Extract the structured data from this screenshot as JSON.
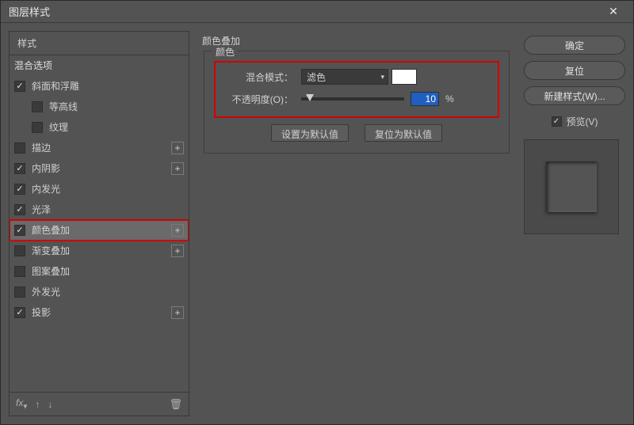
{
  "dialog": {
    "title": "图层样式"
  },
  "left": {
    "styles_header": "样式",
    "blend_options": "混合选项",
    "items": [
      {
        "label": "斜面和浮雕",
        "checked": true,
        "add": false
      },
      {
        "label": "等高线",
        "checked": false,
        "add": false,
        "sub": true
      },
      {
        "label": "纹理",
        "checked": false,
        "add": false,
        "sub": true
      },
      {
        "label": "描边",
        "checked": false,
        "add": true
      },
      {
        "label": "内阴影",
        "checked": true,
        "add": true
      },
      {
        "label": "内发光",
        "checked": true,
        "add": false
      },
      {
        "label": "光泽",
        "checked": true,
        "add": false
      },
      {
        "label": "颜色叠加",
        "checked": true,
        "add": true,
        "selected": true,
        "redbox": true
      },
      {
        "label": "渐变叠加",
        "checked": false,
        "add": true
      },
      {
        "label": "图案叠加",
        "checked": false,
        "add": false
      },
      {
        "label": "外发光",
        "checked": false,
        "add": false
      },
      {
        "label": "投影",
        "checked": true,
        "add": true
      }
    ],
    "footer_fx": "fx"
  },
  "center": {
    "section_title": "颜色叠加",
    "fieldset_label": "颜色",
    "blend_mode_label": "混合模式：",
    "blend_mode_value": "滤色",
    "opacity_label": "不透明度(O)：",
    "opacity_value": "10",
    "opacity_unit": "%",
    "set_default": "设置为默认值",
    "reset_default": "复位为默认值",
    "swatch_color": "#ffffff"
  },
  "right": {
    "ok": "确定",
    "cancel": "复位",
    "new_style": "新建样式(W)...",
    "preview_label": "预览(V)"
  }
}
